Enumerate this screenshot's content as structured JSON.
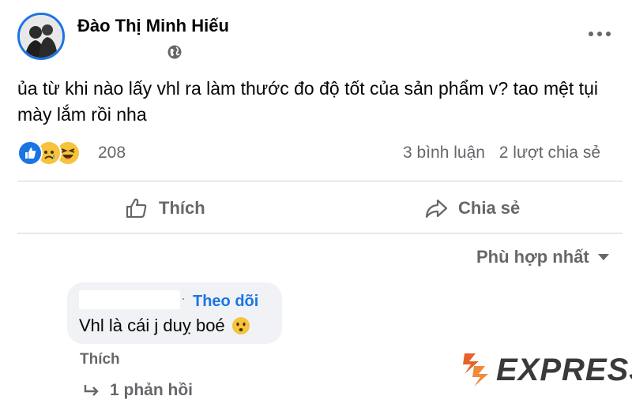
{
  "post": {
    "author": "Đào Thị Minh Hiếu",
    "privacy_icon": "globe-icon",
    "text": "ủa từ khi nào lấy vhl ra làm thước đo độ tốt của sản phẩm v? tao mệt tụi mày lắm rồi nha",
    "reactions": {
      "types": [
        "like",
        "sad",
        "haha"
      ],
      "count": "208"
    },
    "comments_count": "3 bình luận",
    "shares_count": "2 lượt chia sẻ"
  },
  "actions": {
    "like": "Thích",
    "share": "Chia sẻ"
  },
  "sort": {
    "label": "Phù hợp nhất"
  },
  "comment": {
    "separator": "·",
    "follow": "Theo dõi",
    "text": "Vhl là cái j duỵ boé",
    "emoji": "hushed-face",
    "like": "Thích",
    "replies": "1 phản hồi"
  },
  "watermark": {
    "text": "EXPRESS"
  },
  "colors": {
    "accent": "#1b74e4",
    "secondary_text": "#65676b",
    "bubble": "#f0f2f5",
    "divider": "#ced0d4"
  }
}
